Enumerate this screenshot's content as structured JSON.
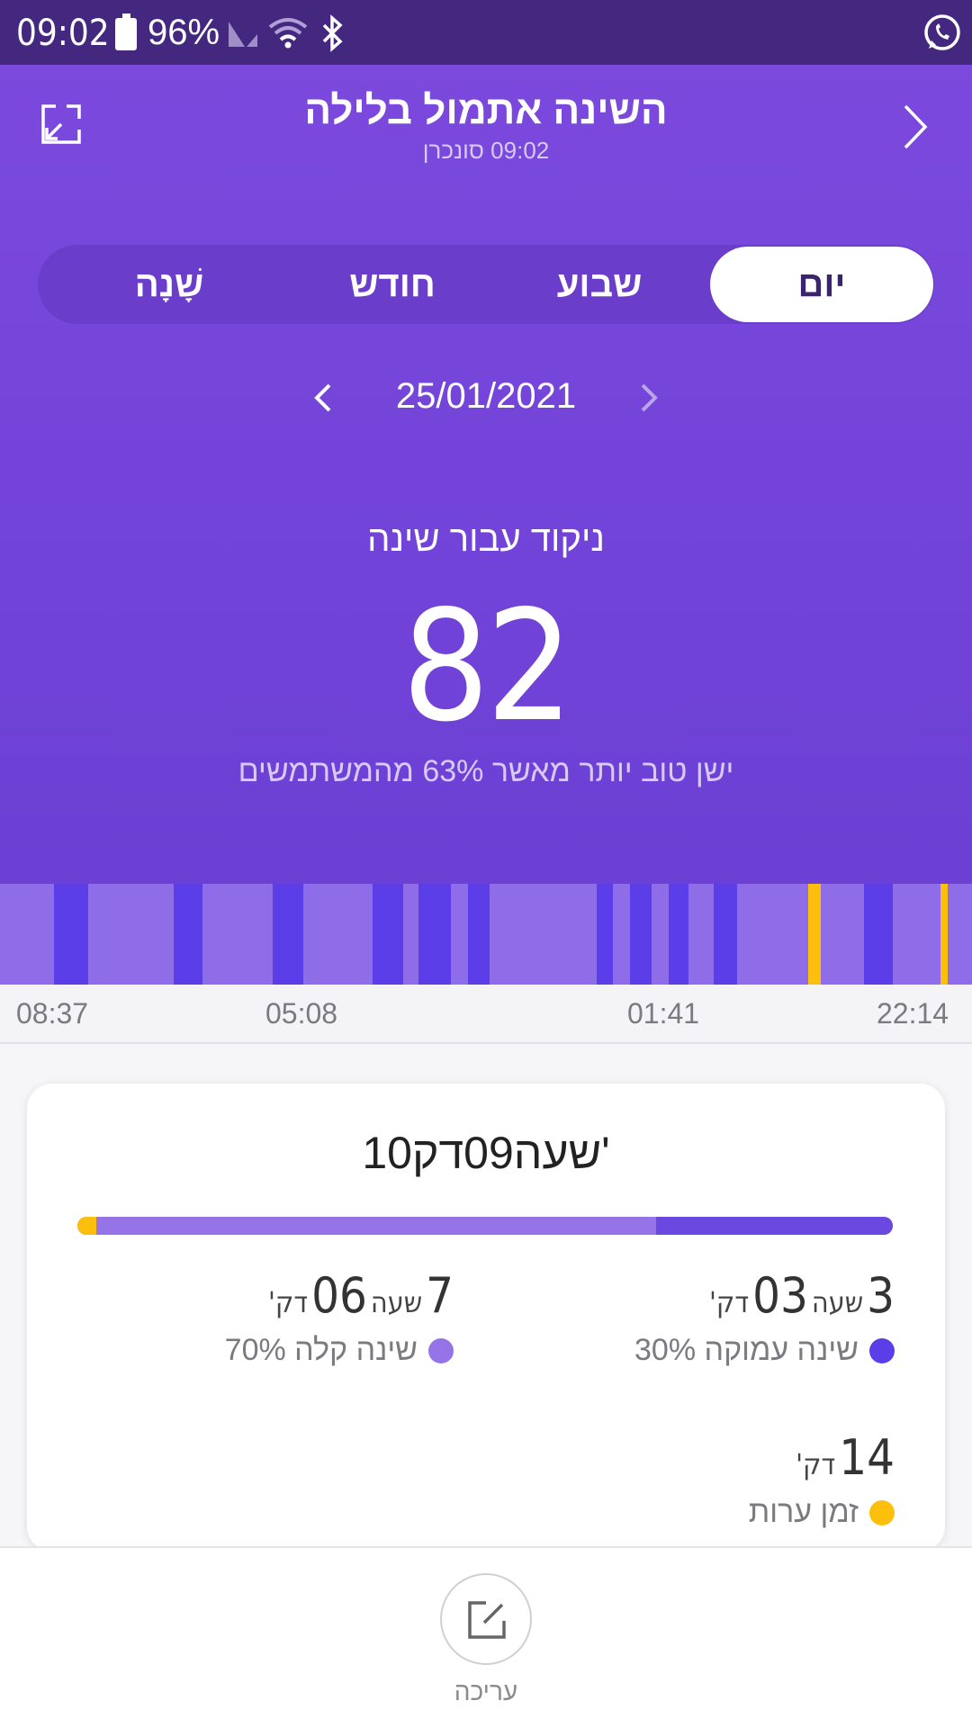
{
  "status_bar": {
    "time": "09:02",
    "battery": "96%",
    "icons": [
      "battery-icon",
      "signal-icon",
      "wifi-icon",
      "bluetooth-icon",
      "whatsapp-icon"
    ]
  },
  "header": {
    "title": "השינה אתמול בלילה",
    "subtitle": "09:02 סונכרן",
    "colors": {
      "background": "#7444da",
      "status_bar": "#44287f"
    }
  },
  "tabs": [
    {
      "label": "יום",
      "active": true
    },
    {
      "label": "שבוע",
      "active": false
    },
    {
      "label": "חודש",
      "active": false
    },
    {
      "label": "שָׁנָה",
      "active": false
    }
  ],
  "date_nav": {
    "date": "25/01/2021"
  },
  "score": {
    "label": "ניקוד עבור שינה",
    "value": "82",
    "comparison": "ישן טוב יותר מאשר 63% מהמשתמשים"
  },
  "timeline": {
    "labels": [
      "08:37",
      "05:08",
      "01:41",
      "22:14"
    ],
    "colors": {
      "light": "#8f6de8",
      "deep": "#5c3ee8",
      "awake": "#fbbf0c"
    }
  },
  "summary": {
    "total": "10שעה09דק'",
    "bar_shares": {
      "awake": 0.023,
      "light": 0.687,
      "deep": 0.29
    },
    "deep": {
      "hours": "3",
      "hours_unit": "שעה",
      "minutes": "03",
      "minutes_unit": "דק'",
      "label": "שינה עמוקה 30%",
      "color": "#5c3ee8"
    },
    "light": {
      "hours": "7",
      "hours_unit": "שעה",
      "minutes": "06",
      "minutes_unit": "דק'",
      "label": "שינה קלה 70%",
      "color": "#9574e8"
    },
    "awake": {
      "minutes": "14",
      "minutes_unit": "דק'",
      "label": "זמן ערות",
      "color": "#fbbf0c"
    }
  },
  "bottom": {
    "edit_label": "עריכה",
    "icon": "edit-icon"
  }
}
